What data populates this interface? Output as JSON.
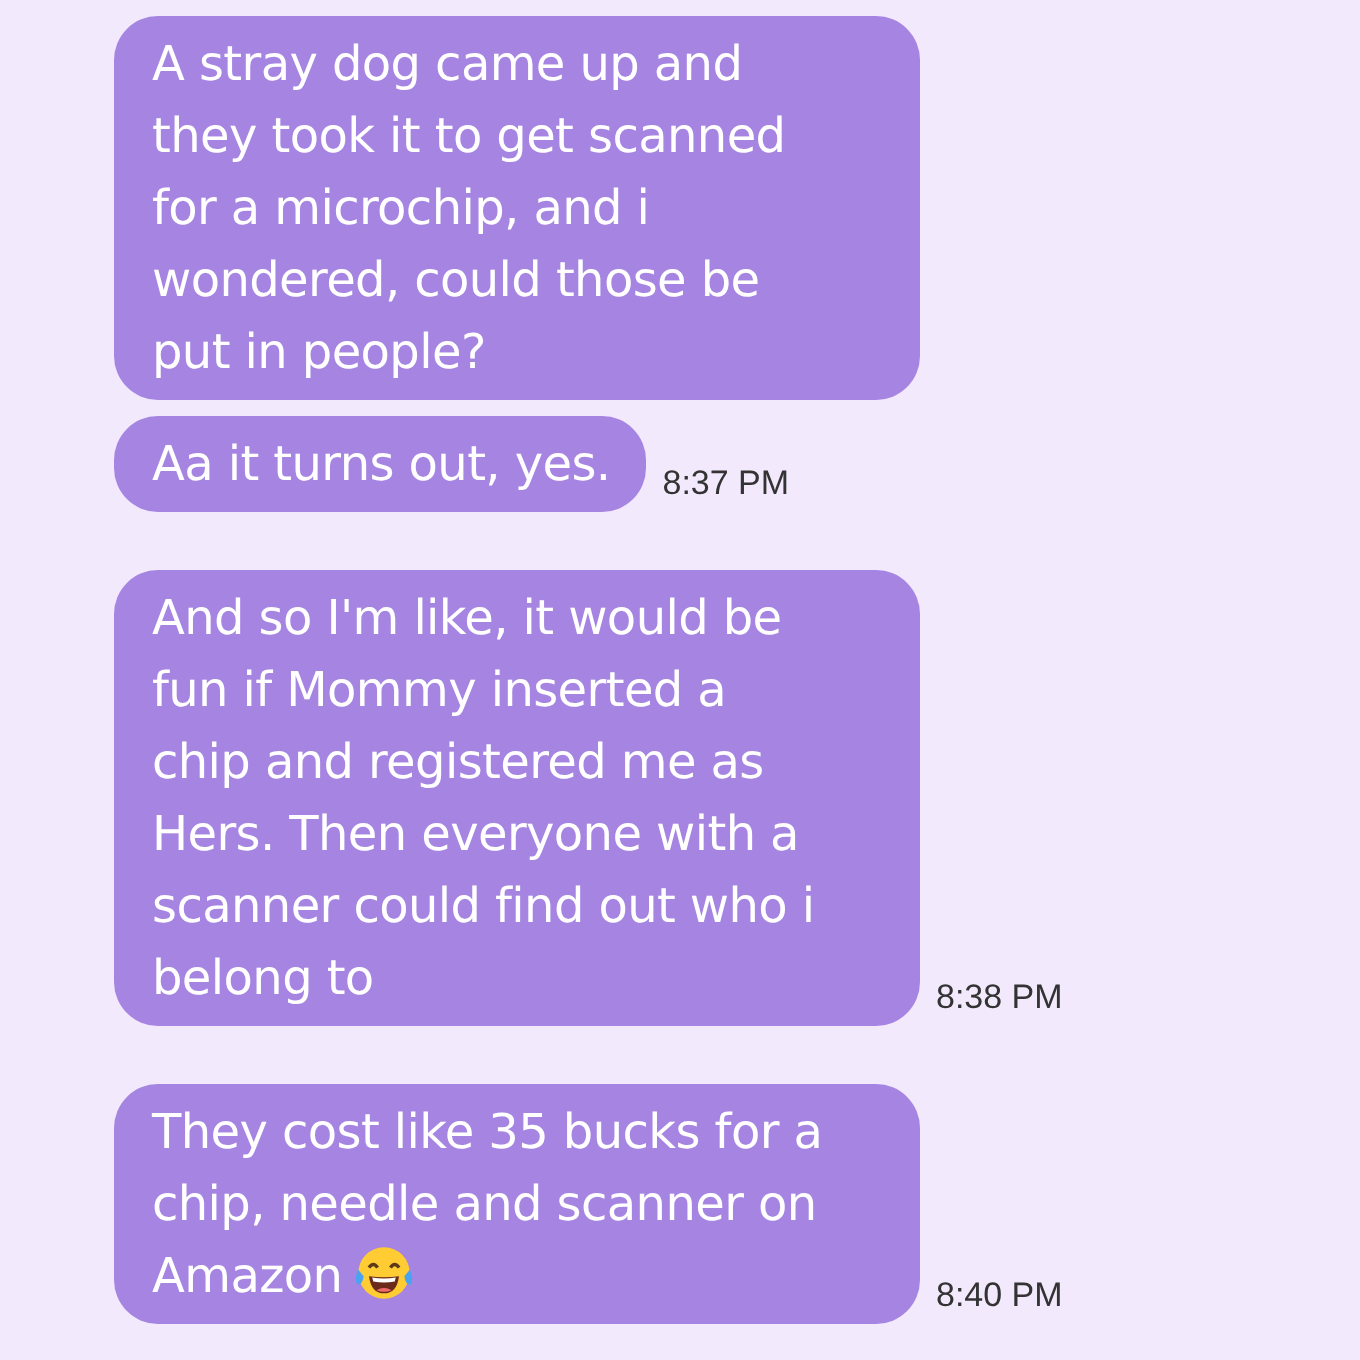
{
  "messages": [
    {
      "lines": [
        "A stray dog came up and",
        "they took it to get scanned",
        "for a microchip, and i",
        "wondered, could those be",
        "put in people?"
      ]
    },
    {
      "lines": [
        "Aa it turns out, yes."
      ],
      "time": "8:37 PM"
    },
    {
      "lines": [
        "And so I'm like, it would be",
        "fun if Mommy inserted a",
        "chip and registered me as",
        "Hers. Then everyone with a",
        "scanner could find out who i",
        "belong to"
      ],
      "time": "8:38 PM"
    },
    {
      "lines": [
        "They cost like 35 bucks for a",
        "chip, needle and scanner on",
        "Amazon"
      ],
      "trailing_emoji": true,
      "time": "8:40 PM"
    }
  ]
}
